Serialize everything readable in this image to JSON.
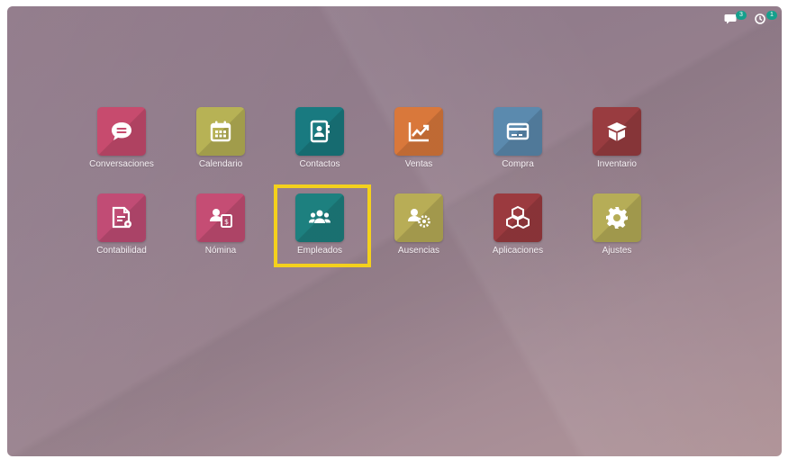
{
  "topbar": {
    "messages_badge": "3",
    "activity_badge": "1"
  },
  "apps": [
    {
      "label": "Conversaciones",
      "icon": "chat-icon",
      "color": "#c74b6e"
    },
    {
      "label": "Calendario",
      "icon": "calendar-icon",
      "color": "#b7b255"
    },
    {
      "label": "Contactos",
      "icon": "address-book-icon",
      "color": "#197a80"
    },
    {
      "label": "Ventas",
      "icon": "sales-chart-icon",
      "color": "#d9783b"
    },
    {
      "label": "Compra",
      "icon": "credit-card-icon",
      "color": "#5b8aae"
    },
    {
      "label": "Inventario",
      "icon": "box-icon",
      "color": "#993c40"
    },
    {
      "label": "Contabilidad",
      "icon": "invoice-icon",
      "color": "#c14c75"
    },
    {
      "label": "Nómina",
      "icon": "payroll-icon",
      "color": "#c54d74"
    },
    {
      "label": "Empleados",
      "icon": "employees-icon",
      "color": "#1d807f"
    },
    {
      "label": "Ausencias",
      "icon": "time-off-icon",
      "color": "#b8ad56"
    },
    {
      "label": "Aplicaciones",
      "icon": "cubes-icon",
      "color": "#9b3a3f"
    },
    {
      "label": "Ajustes",
      "icon": "gear-icon",
      "color": "#b6ad57"
    }
  ],
  "colors": {
    "highlight": "#f4d11c",
    "badge": "#14a08c"
  }
}
